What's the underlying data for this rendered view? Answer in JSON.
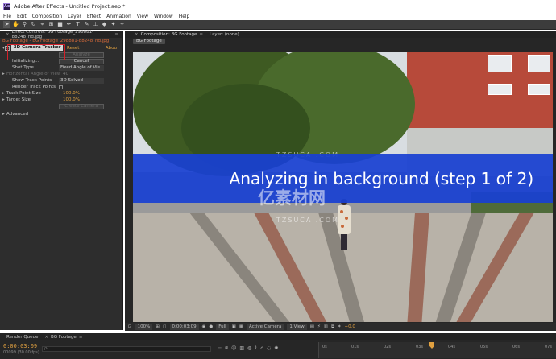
{
  "window": {
    "title": "Adobe After Effects - Untitled Project.aep *"
  },
  "menu": [
    "File",
    "Edit",
    "Composition",
    "Layer",
    "Effect",
    "Animation",
    "View",
    "Window",
    "Help"
  ],
  "effect_controls": {
    "tab": "Effect Controls: BG Footage_298881-88248_hd.jpg",
    "subtitle": "BG Footage - BG Footage_298881-88248_hd.jpg",
    "effect_name": "3D Camera Tracker",
    "reset": "Reset",
    "about": "Abou",
    "analyze": "Analyze",
    "status": "Initializing...",
    "cancel": "Cancel",
    "shot_type_label": "Shot Type",
    "shot_type_value": "Fixed Angle of Vie",
    "fov_label": "Horizontal Angle of View",
    "fov_value": "40",
    "show_track_points_label": "Show Track Points",
    "show_track_points_value": "3D Solved",
    "render_track_points_label": "Render Track Points",
    "track_point_size_label": "Track Point Size",
    "track_point_size_value": "100.0%",
    "target_size_label": "Target Size",
    "target_size_value": "100.0%",
    "create_camera": "Create Camera",
    "advanced": "Advanced"
  },
  "composition": {
    "tab": "Composition: BG Footage",
    "layer_tab": "Layer: (none)",
    "sub_tab": "BG Footage",
    "banner_text": "Analyzing in background (step 1 of 2)",
    "watermark_1": "TZSUCAI.COM",
    "watermark_2": "亿素材网",
    "watermark_3": "TZSUCAI.COM"
  },
  "viewer_footer": {
    "zoom": "100%",
    "timecode": "0:00:03:09",
    "resolution": "Full",
    "camera": "Active Camera",
    "views": "1 View",
    "exposure": "+0.0"
  },
  "timeline": {
    "tabs": [
      "Render Queue",
      "BG Footage"
    ],
    "timecode": "0:00:03:09",
    "fps": "00099 (30.00 fps)",
    "search_placeholder": "ρ-",
    "ticks": [
      "0s",
      "01s",
      "02s",
      "03s",
      "04s",
      "05s",
      "06s",
      "07s"
    ]
  }
}
